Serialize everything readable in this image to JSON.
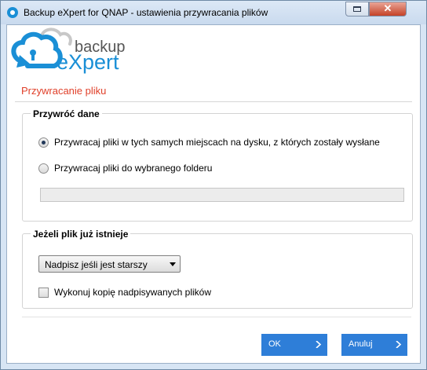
{
  "window": {
    "title": "Backup eXpert for QNAP - ustawienia przywracania plików"
  },
  "logo": {
    "line1": "backup",
    "line2": "eXpert",
    "color": "#1a8fd6"
  },
  "section_title": "Przywracanie pliku",
  "restore_group": {
    "legend": "Przywróć dane",
    "option_same_location": "Przywracaj pliki w tych samych miejscach na dysku, z których zostały wysłane",
    "option_selected_folder": "Przywracaj pliki do wybranego folderu",
    "selected_option": "same_location",
    "folder_value": ""
  },
  "exists_group": {
    "legend": "Jeżeli plik już istnieje",
    "selected_action": "Nadpisz jeśli jest starszy",
    "backup_overwritten_label": "Wykonuj kopię nadpisywanych plików",
    "backup_overwritten_checked": false
  },
  "buttons": {
    "ok": "OK",
    "cancel": "Anuluj"
  },
  "colors": {
    "accent": "#2e7ed8",
    "section_title": "#e0402a"
  },
  "icons": {
    "app": "backup-expert-app-icon",
    "restore": "restore-window-icon",
    "close": "close-icon",
    "button_arrow": "chevron-right-icon"
  }
}
